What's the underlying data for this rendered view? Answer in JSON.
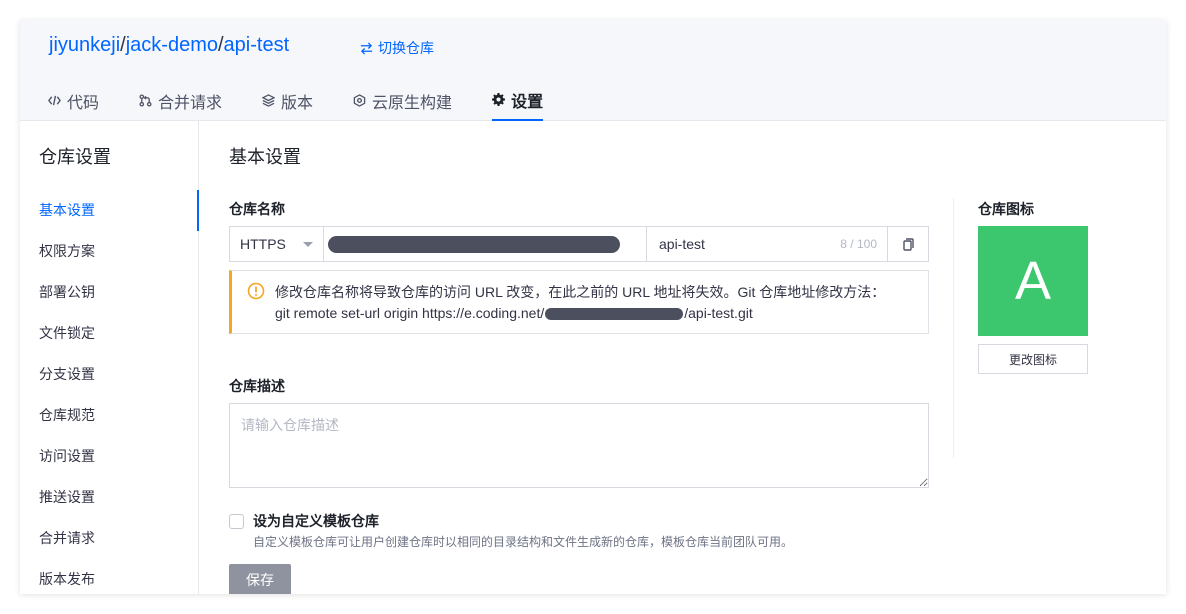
{
  "repo": {
    "team": "jiyunkeji",
    "separator": "/",
    "project": "jack-demo",
    "name": "api-test",
    "switch_label": "切换仓库"
  },
  "tabs": [
    {
      "label": "代码",
      "icon": "code-icon"
    },
    {
      "label": "合并请求",
      "icon": "merge-request-icon"
    },
    {
      "label": "版本",
      "icon": "layers-icon"
    },
    {
      "label": "云原生构建",
      "icon": "build-icon"
    },
    {
      "label": "设置",
      "icon": "gear-icon",
      "active": true
    }
  ],
  "sidebar": {
    "title": "仓库设置",
    "items": [
      {
        "label": "基本设置",
        "active": true
      },
      {
        "label": "权限方案"
      },
      {
        "label": "部署公钥"
      },
      {
        "label": "文件锁定"
      },
      {
        "label": "分支设置"
      },
      {
        "label": "仓库规范"
      },
      {
        "label": "访问设置"
      },
      {
        "label": "推送设置"
      },
      {
        "label": "合并请求"
      },
      {
        "label": "版本发布"
      }
    ]
  },
  "main": {
    "title": "基本设置",
    "name_label": "仓库名称",
    "protocol": "HTTPS",
    "name_value": "api-test",
    "name_count": "8 / 100",
    "warning_line1": "修改仓库名称将导致仓库的访问 URL 改变，在此之前的 URL 地址将失效。Git 仓库地址修改方法：",
    "warning_line2_prefix": "git remote set-url origin https://e.coding.net/",
    "warning_line2_suffix": "/api-test.git",
    "desc_label": "仓库描述",
    "desc_placeholder": "请输入仓库描述",
    "template_label": "设为自定义模板仓库",
    "template_hint": "自定义模板仓库可让用户创建仓库时以相同的目录结构和文件生成新的仓库，模板仓库当前团队可用。",
    "save_label": "保存"
  },
  "icon_panel": {
    "label": "仓库图标",
    "avatar_letter": "A",
    "change_label": "更改图标"
  },
  "colors": {
    "accent": "#0066ff",
    "warning": "#f5a623",
    "avatar_bg": "#3cc76e",
    "save_disabled": "#8f939f"
  }
}
